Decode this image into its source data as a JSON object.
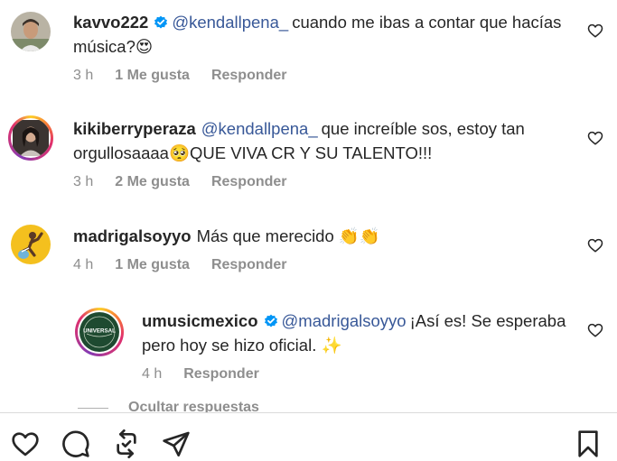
{
  "comments": [
    {
      "username": "kavvo222",
      "verified": true,
      "mention": "@kendallpena_",
      "text": "cuando me ibas a contar que hacías música?😍",
      "time": "3 h",
      "likes": "1 Me gusta",
      "reply_label": "Responder"
    },
    {
      "username": "kikiberryperaza",
      "verified": false,
      "mention": "@kendallpena_",
      "text": "que increíble sos, estoy tan orgullosaaaa🥺QUE VIVA CR Y SU TALENTO!!!",
      "time": "3 h",
      "likes": "2 Me gusta",
      "reply_label": "Responder"
    },
    {
      "username": "madrigalsoyyo",
      "verified": false,
      "mention": "",
      "text": "Más que merecido 👏👏",
      "time": "4 h",
      "likes": "1 Me gusta",
      "reply_label": "Responder"
    }
  ],
  "reply": {
    "username": "umusicmexico",
    "verified": true,
    "mention": "@madrigalsoyyo",
    "text": "¡Así es! Se esperaba pero hoy se hizo oficial. ✨",
    "time": "4 h",
    "reply_label": "Responder",
    "avatar_logo_text": "UNIVERSAL"
  },
  "hide_replies_label": "Ocultar respuestas",
  "bottom_actions": [
    "heart-icon",
    "comment-icon",
    "repost-icon",
    "share-icon",
    "save-icon"
  ],
  "colors": {
    "mention": "#385898",
    "verified": "#0095f6",
    "muted": "#8e8e8e"
  }
}
